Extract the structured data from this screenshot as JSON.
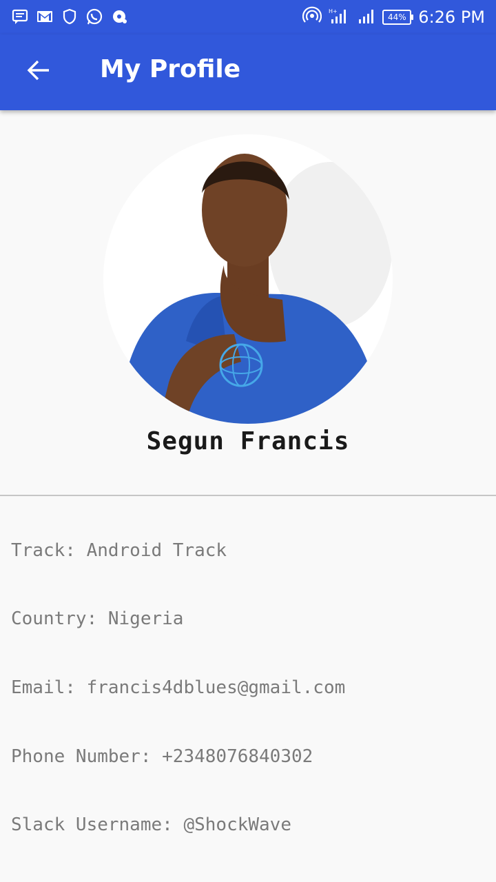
{
  "status_bar": {
    "time": "6:26 PM",
    "battery": "44%"
  },
  "app_bar": {
    "title": "My Profile"
  },
  "profile": {
    "name": "Segun Francis",
    "track": "Track: Android Track",
    "country": "Country: Nigeria",
    "email": "Email: francis4dblues@gmail.com",
    "phone": "Phone Number: +2348076840302",
    "slack": "Slack Username: @ShockWave"
  },
  "colors": {
    "primary": "#3158db",
    "background": "#f9f9f9",
    "text_primary": "#1a1a1a",
    "text_secondary": "#7a7a7a",
    "divider": "#c6c6c6"
  }
}
